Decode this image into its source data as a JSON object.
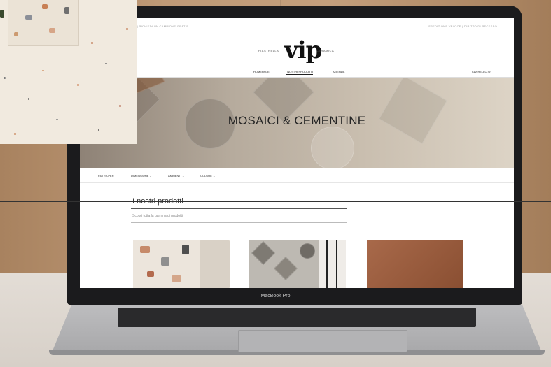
{
  "website": {
    "topbar": {
      "left_text": "ENTO  |  RICHIEDI UN CAMPIONE GRATIS",
      "right_text": "SPEDIZIONE VELOCE  |  DIRITTO DI RECESSO"
    },
    "logo": {
      "left_text": "PIASTRELLA",
      "main": "vip",
      "right_text": "CERAMICA"
    },
    "nav": {
      "items": [
        "HOMEPAGE",
        "I NOSTRI PRODOTTI",
        "AZIENDA"
      ],
      "right": "CARRELLO (0)"
    },
    "hero": {
      "title": "MOSAICI & CEMENTINE"
    },
    "filters": {
      "label": "FILTRA PER",
      "items": [
        "DIMENSIONE ⌄",
        "AMBIENTI ⌄",
        "COLORE ⌄"
      ]
    },
    "products": {
      "title": "I nostri prodotti",
      "subtitle": "Scopri tutta la gamma di prodotti"
    }
  },
  "device": {
    "label": "MacBook Pro"
  },
  "colors": {
    "screen_bg": "#ffffff",
    "bezel": "#1b1b1d",
    "hero_text": "#262626",
    "wall": "#b48f6d"
  }
}
